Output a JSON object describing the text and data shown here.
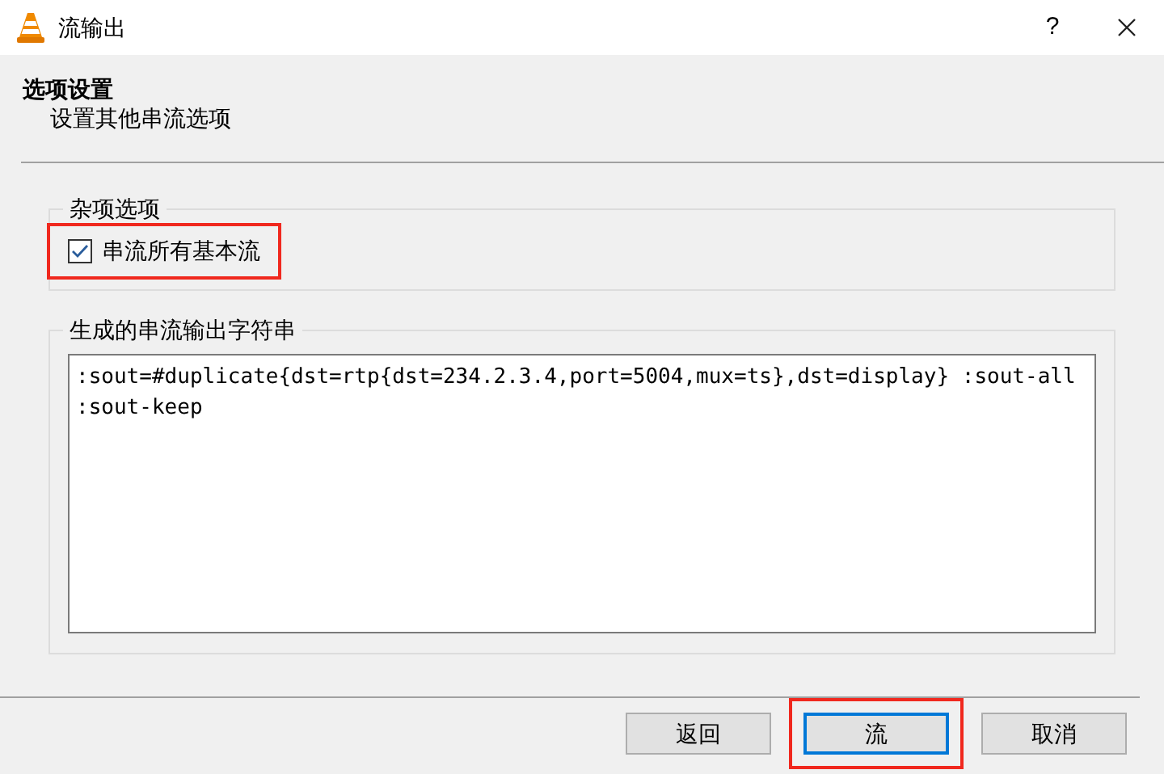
{
  "window": {
    "title": "流输出",
    "help": "?"
  },
  "header": {
    "title": "选项设置",
    "subtitle": "设置其他串流选项"
  },
  "misc_group": {
    "title": "杂项选项",
    "checkbox": {
      "label": "串流所有基本流",
      "checked": true,
      "highlighted": true
    }
  },
  "output_group": {
    "title": "生成的串流输出字符串",
    "value": ":sout=#duplicate{dst=rtp{dst=234.2.3.4,port=5004,mux=ts},dst=display} :sout-all :sout-keep"
  },
  "buttons": [
    {
      "label": "返回",
      "focused": false,
      "highlighted": false
    },
    {
      "label": "流",
      "focused": true,
      "highlighted": true
    },
    {
      "label": "取消",
      "focused": false,
      "highlighted": false
    }
  ]
}
